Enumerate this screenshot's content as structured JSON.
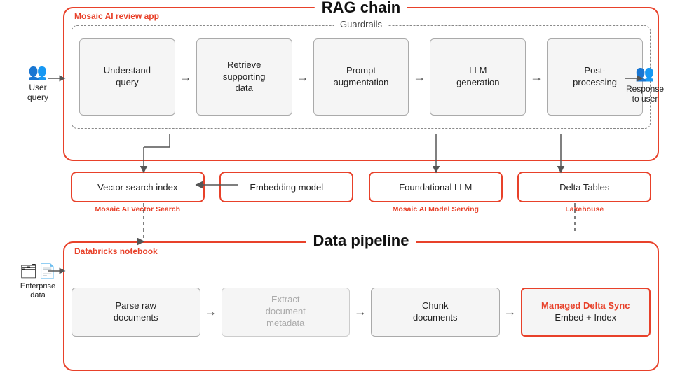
{
  "rag_chain": {
    "title": "RAG chain",
    "mosaic_label": "Mosaic AI review app",
    "guardrails": "Guardrails",
    "steps": [
      {
        "id": "understand-query",
        "label": "Understand\nquery"
      },
      {
        "id": "retrieve-data",
        "label": "Retrieve\nsupporting\ndata"
      },
      {
        "id": "prompt-aug",
        "label": "Prompt\naugmentation"
      },
      {
        "id": "llm-gen",
        "label": "LLM\ngeneration"
      },
      {
        "id": "post-proc",
        "label": "Post-\nprocessing"
      }
    ],
    "user_query_label": "User\nquery",
    "response_label": "Response\nto user"
  },
  "bottom_row": {
    "items": [
      {
        "id": "vector-search",
        "label": "Vector search index",
        "sublabel": "Mosaic AI Vector Search"
      },
      {
        "id": "embedding-model",
        "label": "Embedding model",
        "sublabel": ""
      },
      {
        "id": "foundational-llm",
        "label": "Foundational LLM",
        "sublabel": "Mosaic AI Model Serving"
      },
      {
        "id": "delta-tables",
        "label": "Delta Tables",
        "sublabel": "Lakehouse"
      }
    ]
  },
  "data_pipeline": {
    "title": "Data pipeline",
    "databricks_label": "Databricks notebook",
    "enterprise_label": "Enterprise\ndata",
    "steps": [
      {
        "id": "parse-raw",
        "label": "Parse raw\ndocuments",
        "grayed": false,
        "highlighted": false
      },
      {
        "id": "extract-meta",
        "label": "Extract\ndocument\nmetadata",
        "grayed": true,
        "highlighted": false
      },
      {
        "id": "chunk-docs",
        "label": "Chunk\ndocuments",
        "grayed": false,
        "highlighted": false
      },
      {
        "id": "managed-delta",
        "label_main": "Managed Delta Sync",
        "label_sub": "Embed + Index",
        "grayed": false,
        "highlighted": true
      }
    ]
  },
  "colors": {
    "accent": "#e8412a",
    "border_gray": "#aaa",
    "text_dark": "#222"
  }
}
